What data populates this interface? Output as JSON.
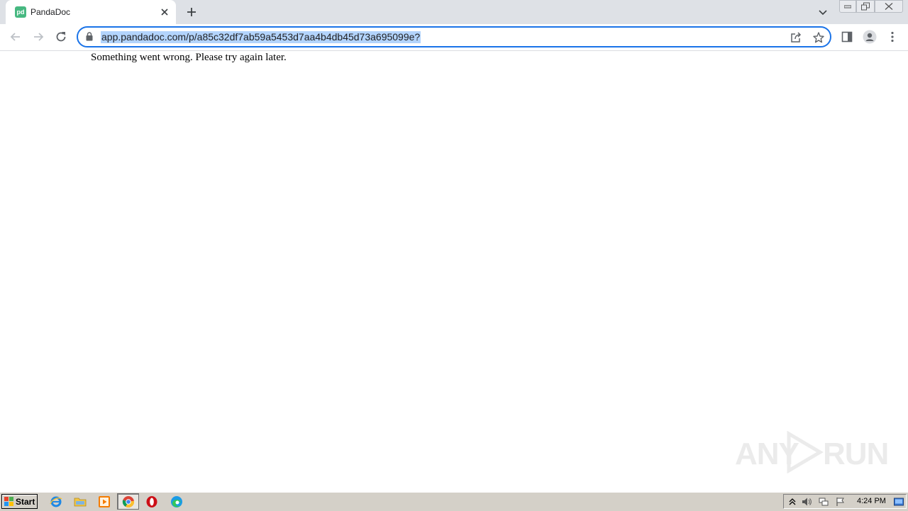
{
  "browser": {
    "tab": {
      "title": "PandaDoc",
      "favicon_text": "pd",
      "favicon_color": "#47b881"
    },
    "address": {
      "url": "app.pandadoc.com/p/a85c32df7ab59a5453d7aa4b4db45d73a695099e?",
      "secure_icon": "lock-icon"
    },
    "accent_color": "#1a73e8"
  },
  "page": {
    "message": "Something went wrong. Please try again later."
  },
  "watermark": {
    "left": "ANY",
    "right": "RUN"
  },
  "taskbar": {
    "start_label": "Start",
    "pinned": [
      "internet-explorer-icon",
      "file-explorer-icon",
      "media-player-icon",
      "chrome-icon",
      "opera-icon",
      "edge-icon"
    ],
    "active": "chrome-icon",
    "clock": "4:24 PM"
  }
}
